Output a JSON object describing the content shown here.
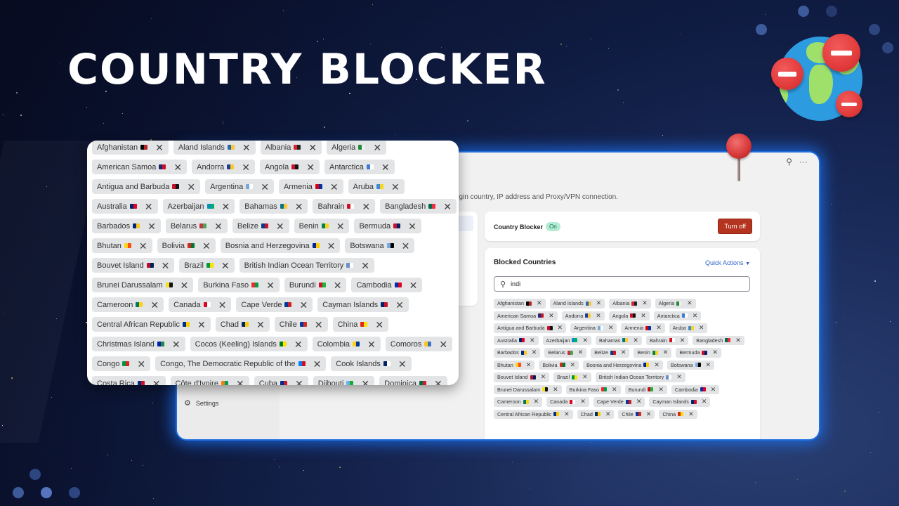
{
  "hero": {
    "title": "COUNTRY BLOCKER"
  },
  "window": {
    "icons": {
      "pin": "pin-icon",
      "more": "more-icon"
    },
    "description_partial": "rigin country, IP address and Proxy/VPN connection.",
    "sidebar": {
      "settings_label": "Settings",
      "settings_icon": "gear-icon"
    },
    "status_card": {
      "label": "Country Blocker",
      "badge": "On",
      "button": "Turn off",
      "button_color": "#b5341f"
    },
    "blocked_card": {
      "title": "Blocked Countries",
      "quick_actions": "Quick Actions",
      "search_value": "indi",
      "accent": "#2f63c9"
    }
  },
  "countries": [
    {
      "name": "Afghanistan",
      "c1": "#000",
      "c2": "#b8262b"
    },
    {
      "name": "Aland Islands",
      "c1": "#2c67b0",
      "c2": "#f6c83c"
    },
    {
      "name": "Albania",
      "c1": "#d8242b",
      "c2": "#222"
    },
    {
      "name": "Algeria",
      "c1": "#1f8a3b",
      "c2": "#eee"
    },
    {
      "name": "American Samoa",
      "c1": "#1b2a6e",
      "c2": "#c8102e"
    },
    {
      "name": "Andorra",
      "c1": "#1c3f9a",
      "c2": "#f7c92b"
    },
    {
      "name": "Angola",
      "c1": "#c8102e",
      "c2": "#111"
    },
    {
      "name": "Antarctica",
      "c1": "#3a7bd5",
      "c2": "#fff"
    },
    {
      "name": "Antigua and Barbuda",
      "c1": "#c8102e",
      "c2": "#111"
    },
    {
      "name": "Argentina",
      "c1": "#75aadb",
      "c2": "#fff"
    },
    {
      "name": "Armenia",
      "c1": "#d90012",
      "c2": "#0033a0"
    },
    {
      "name": "Aruba",
      "c1": "#4189dd",
      "c2": "#f9d616"
    },
    {
      "name": "Australia",
      "c1": "#012169",
      "c2": "#e4002b"
    },
    {
      "name": "Azerbaijan",
      "c1": "#0092bc",
      "c2": "#00af66"
    },
    {
      "name": "Bahamas",
      "c1": "#00778b",
      "c2": "#ffc72c"
    },
    {
      "name": "Bahrain",
      "c1": "#ce1126",
      "c2": "#fff"
    },
    {
      "name": "Bangladesh",
      "c1": "#006a4e",
      "c2": "#f42a41"
    },
    {
      "name": "Barbados",
      "c1": "#00267f",
      "c2": "#ffc726"
    },
    {
      "name": "Belarus",
      "c1": "#c8313e",
      "c2": "#4aa657"
    },
    {
      "name": "Belize",
      "c1": "#003f87",
      "c2": "#ce1126"
    },
    {
      "name": "Benin",
      "c1": "#008751",
      "c2": "#fcd116"
    },
    {
      "name": "Bermuda",
      "c1": "#c8102e",
      "c2": "#012169"
    },
    {
      "name": "Bhutan",
      "c1": "#ffd520",
      "c2": "#ff4e12"
    },
    {
      "name": "Bolivia",
      "c1": "#d52b1e",
      "c2": "#007934"
    },
    {
      "name": "Bosnia and Herzegovina",
      "c1": "#002395",
      "c2": "#fecb00"
    },
    {
      "name": "Botswana",
      "c1": "#75aadb",
      "c2": "#000"
    },
    {
      "name": "Bouvet Island",
      "c1": "#ba0c2f",
      "c2": "#00205b"
    },
    {
      "name": "Brazil",
      "c1": "#009c3b",
      "c2": "#ffdf00"
    },
    {
      "name": "British Indian Ocean Territory",
      "c1": "#6b8fc9",
      "c2": "#fff"
    },
    {
      "name": "Brunei Darussalam",
      "c1": "#f7e017",
      "c2": "#111"
    },
    {
      "name": "Burkina Faso",
      "c1": "#ef2b2d",
      "c2": "#009e49"
    },
    {
      "name": "Burundi",
      "c1": "#ce1126",
      "c2": "#1eb53a"
    },
    {
      "name": "Cambodia",
      "c1": "#032ea1",
      "c2": "#e00025"
    },
    {
      "name": "Cameroon",
      "c1": "#007a5e",
      "c2": "#fcd116"
    },
    {
      "name": "Canada",
      "c1": "#d80621",
      "c2": "#fff"
    },
    {
      "name": "Cape Verde",
      "c1": "#003893",
      "c2": "#cf2027"
    },
    {
      "name": "Cayman Islands",
      "c1": "#012169",
      "c2": "#c8102e"
    },
    {
      "name": "Central African Republic",
      "c1": "#003082",
      "c2": "#ffce00"
    },
    {
      "name": "Chad",
      "c1": "#002664",
      "c2": "#fecb00"
    },
    {
      "name": "Chile",
      "c1": "#0039a6",
      "c2": "#d52b1e"
    },
    {
      "name": "China",
      "c1": "#de2910",
      "c2": "#ffde00"
    },
    {
      "name": "Christmas Island",
      "c1": "#0021ad",
      "c2": "#1c8a42"
    },
    {
      "name": "Cocos (Keeling) Islands",
      "c1": "#008000",
      "c2": "#ffe000"
    },
    {
      "name": "Colombia",
      "c1": "#fcd116",
      "c2": "#003893"
    },
    {
      "name": "Comoros",
      "c1": "#ffc61e",
      "c2": "#3a75c4"
    },
    {
      "name": "Congo",
      "c1": "#009543",
      "c2": "#dc241f"
    },
    {
      "name": "Congo, The Democratic Republic of the",
      "c1": "#007fff",
      "c2": "#ce1021"
    },
    {
      "name": "Cook Islands",
      "c1": "#012169",
      "c2": "#fff"
    },
    {
      "name": "Costa Rica",
      "c1": "#002b7f",
      "c2": "#ce1126"
    },
    {
      "name": "Côte d'Ivoire",
      "c1": "#f77f00",
      "c2": "#009e60"
    },
    {
      "name": "Cuba",
      "c1": "#002a8f",
      "c2": "#cf142b"
    },
    {
      "name": "Djibouti",
      "c1": "#6ab2e7",
      "c2": "#12ad2b"
    },
    {
      "name": "Dominica",
      "c1": "#006b3f",
      "c2": "#d41c30"
    }
  ]
}
